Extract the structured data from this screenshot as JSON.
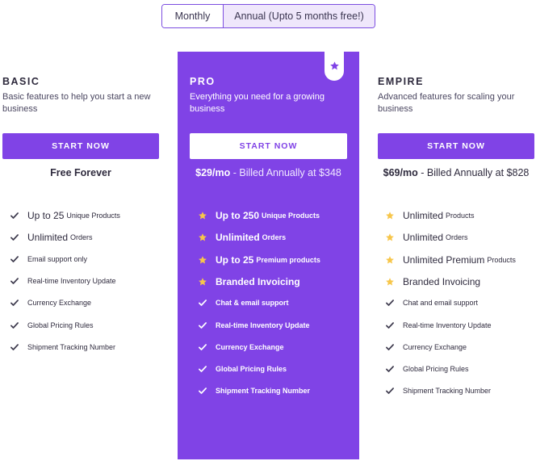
{
  "billing_toggle": {
    "monthly_label": "Monthly",
    "annual_label": "Annual (Upto 5 months free!)"
  },
  "colors": {
    "accent": "#8043e6",
    "star": "#f7c64a",
    "text": "#2e2a3d"
  },
  "plans": {
    "basic": {
      "name": "BASIC",
      "description": "Basic features to help you start a new business",
      "cta": "START NOW",
      "price_main": "Free Forever",
      "price_rest": "",
      "features": [
        {
          "icon": "check-icon",
          "big": "Up to 25",
          "small": "Unique Products"
        },
        {
          "icon": "check-icon",
          "big": "Unlimited",
          "small": "Orders"
        },
        {
          "icon": "check-icon",
          "big": "",
          "small": "Email support only"
        },
        {
          "icon": "check-icon",
          "big": "",
          "small": "Real-time Inventory Update"
        },
        {
          "icon": "check-icon",
          "big": "",
          "small": "Currency Exchange"
        },
        {
          "icon": "check-icon",
          "big": "",
          "small": "Global Pricing Rules"
        },
        {
          "icon": "check-icon",
          "big": "",
          "small": "Shipment Tracking Number"
        }
      ]
    },
    "pro": {
      "name": "PRO",
      "description": "Everything you need for a growing business",
      "cta": "START NOW",
      "price_main": "$29/mo",
      "price_rest": " - Billed Annually at $348",
      "features": [
        {
          "icon": "star-icon",
          "big": "Up to 250",
          "small": "Unique Products"
        },
        {
          "icon": "star-icon",
          "big": "Unlimited",
          "small": "Orders"
        },
        {
          "icon": "star-icon",
          "big": "Up to 25",
          "small": "Premium products"
        },
        {
          "icon": "star-icon",
          "big": "Branded Invoicing",
          "small": ""
        },
        {
          "icon": "check-icon",
          "big": "",
          "small": "Chat & email support"
        },
        {
          "icon": "check-icon",
          "big": "",
          "small": "Real-time Inventory Update"
        },
        {
          "icon": "check-icon",
          "big": "",
          "small": "Currency Exchange"
        },
        {
          "icon": "check-icon",
          "big": "",
          "small": "Global Pricing Rules"
        },
        {
          "icon": "check-icon",
          "big": "",
          "small": "Shipment Tracking Number"
        }
      ]
    },
    "empire": {
      "name": "EMPIRE",
      "description": "Advanced features for scaling your business",
      "cta": "START NOW",
      "price_main": "$69/mo",
      "price_rest": " - Billed Annually at $828",
      "features": [
        {
          "icon": "star-icon",
          "big": "Unlimited",
          "small": "Products"
        },
        {
          "icon": "star-icon",
          "big": "Unlimited",
          "small": "Orders"
        },
        {
          "icon": "star-icon",
          "big": "Unlimited Premium",
          "small": "Products"
        },
        {
          "icon": "star-icon",
          "big": "Branded Invoicing",
          "small": ""
        },
        {
          "icon": "check-icon",
          "big": "",
          "small": "Chat and email support"
        },
        {
          "icon": "check-icon",
          "big": "",
          "small": "Real-time Inventory Update"
        },
        {
          "icon": "check-icon",
          "big": "",
          "small": "Currency Exchange"
        },
        {
          "icon": "check-icon",
          "big": "",
          "small": "Global Pricing Rules"
        },
        {
          "icon": "check-icon",
          "big": "",
          "small": "Shipment Tracking Number"
        }
      ]
    }
  }
}
